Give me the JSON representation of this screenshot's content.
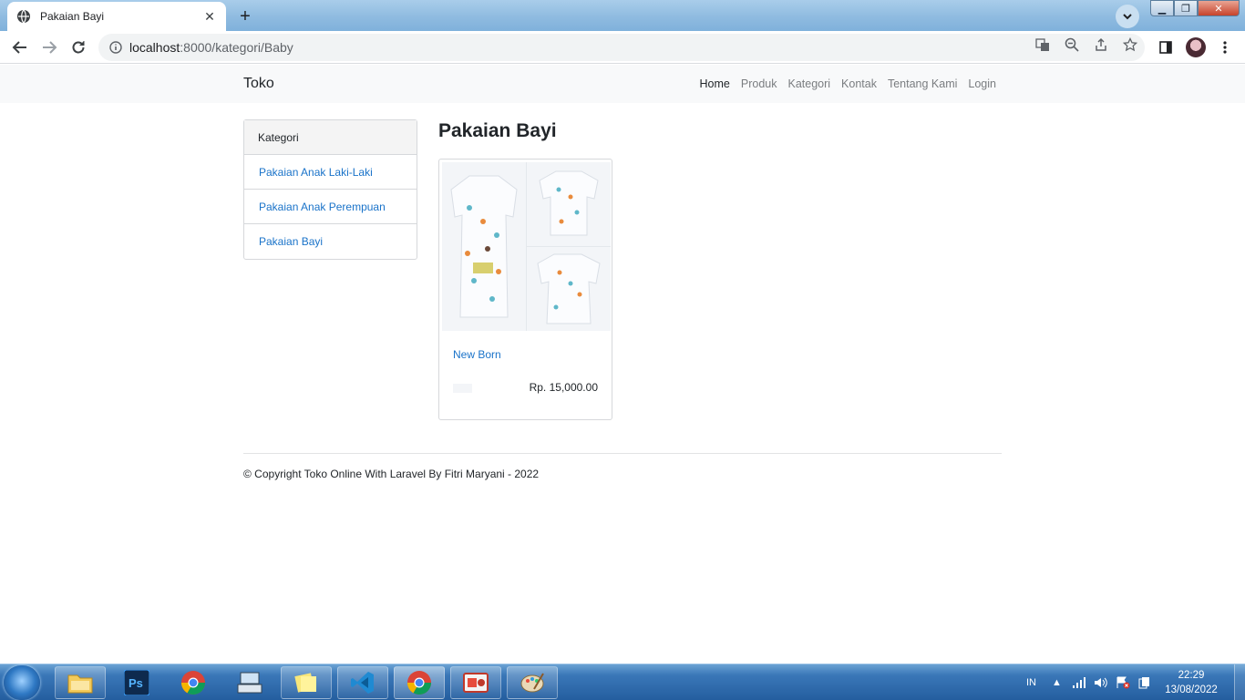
{
  "browser": {
    "tab_title": "Pakaian Bayi",
    "url_host": "localhost",
    "url_path": ":8000/kategori/Baby"
  },
  "site": {
    "brand": "Toko",
    "nav": [
      "Home",
      "Produk",
      "Kategori",
      "Kontak",
      "Tentang Kami",
      "Login"
    ],
    "active_nav": "Home"
  },
  "sidebar": {
    "header": "Kategori",
    "items": [
      "Pakaian Anak Laki-Laki",
      "Pakaian Anak Perempuan",
      "Pakaian Bayi"
    ]
  },
  "main": {
    "title": "Pakaian Bayi",
    "products": [
      {
        "name": "New Born",
        "price": "Rp. 15,000.00"
      }
    ]
  },
  "footer": {
    "text": "© Copyright Toko Online With Laravel By Fitri Maryani - 2022"
  },
  "taskbar": {
    "language": "IN",
    "time": "22:29",
    "date": "13/08/2022",
    "apps": [
      "file-explorer",
      "photoshop",
      "chrome",
      "keyboard",
      "sticky-notes",
      "vscode",
      "chrome-active",
      "screen-recorder",
      "paint"
    ]
  },
  "colors": {
    "link": "#1a73c9",
    "navbar_bg": "#f8f9fa",
    "taskbar": "#245e9f",
    "titlebar": "#8fbbe0"
  }
}
